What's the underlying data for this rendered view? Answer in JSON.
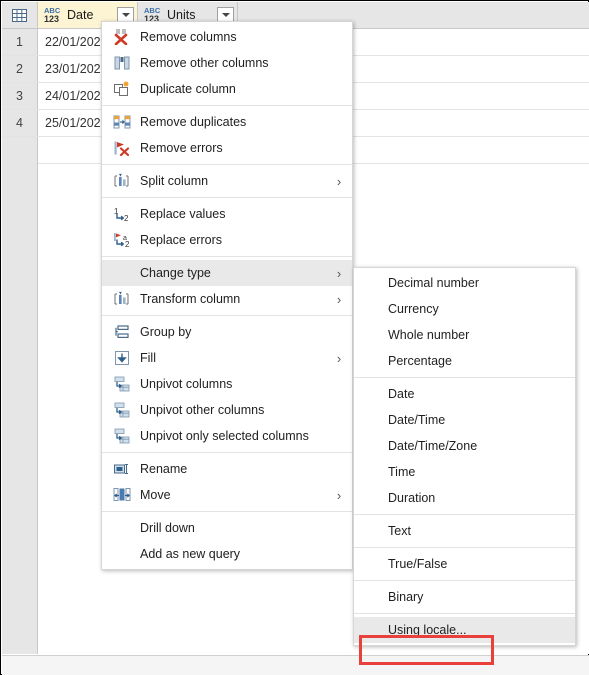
{
  "grid": {
    "corner_icon": "select-all-table-icon",
    "columns": [
      {
        "name": "Date",
        "type_icon": "abc123-any-type-icon",
        "selected": true,
        "width": 100,
        "filter_icon": "filter-dropdown-icon"
      },
      {
        "name": "Units",
        "type_icon": "abc123-any-type-icon",
        "selected": false,
        "width": 100,
        "filter_icon": "filter-dropdown-icon"
      }
    ],
    "rows": [
      {
        "num": "1",
        "cells": [
          "22/01/202",
          ""
        ]
      },
      {
        "num": "2",
        "cells": [
          "23/01/202",
          ""
        ]
      },
      {
        "num": "3",
        "cells": [
          "24/01/202",
          ""
        ]
      },
      {
        "num": "4",
        "cells": [
          "25/01/202",
          ""
        ]
      }
    ]
  },
  "context_menu": {
    "groups": [
      {
        "items": [
          {
            "label": "Remove columns",
            "icon": "remove-columns-icon",
            "submenu": false,
            "highlighted": false
          },
          {
            "label": "Remove other columns",
            "icon": "remove-other-columns-icon",
            "submenu": false,
            "highlighted": false
          },
          {
            "label": "Duplicate column",
            "icon": "duplicate-column-icon",
            "submenu": false,
            "highlighted": false
          }
        ]
      },
      {
        "items": [
          {
            "label": "Remove duplicates",
            "icon": "remove-duplicates-icon",
            "submenu": false,
            "highlighted": false
          },
          {
            "label": "Remove errors",
            "icon": "remove-errors-icon",
            "submenu": false,
            "highlighted": false
          }
        ]
      },
      {
        "items": [
          {
            "label": "Split column",
            "icon": "split-column-icon",
            "submenu": true,
            "highlighted": false
          }
        ]
      },
      {
        "items": [
          {
            "label": "Replace values",
            "icon": "replace-values-icon",
            "submenu": false,
            "highlighted": false
          },
          {
            "label": "Replace errors",
            "icon": "replace-errors-icon",
            "submenu": false,
            "highlighted": false
          }
        ]
      },
      {
        "items": [
          {
            "label": "Change type",
            "icon": "none",
            "submenu": true,
            "highlighted": true
          },
          {
            "label": "Transform column",
            "icon": "transform-column-icon",
            "submenu": true,
            "highlighted": false
          }
        ]
      },
      {
        "items": [
          {
            "label": "Group by",
            "icon": "group-by-icon",
            "submenu": false,
            "highlighted": false
          },
          {
            "label": "Fill",
            "icon": "fill-down-icon",
            "submenu": true,
            "highlighted": false
          },
          {
            "label": "Unpivot columns",
            "icon": "unpivot-icon",
            "submenu": false,
            "highlighted": false
          },
          {
            "label": "Unpivot other columns",
            "icon": "unpivot-icon",
            "submenu": false,
            "highlighted": false
          },
          {
            "label": "Unpivot only selected columns",
            "icon": "unpivot-icon",
            "submenu": false,
            "highlighted": false
          }
        ]
      },
      {
        "items": [
          {
            "label": "Rename",
            "icon": "rename-icon",
            "submenu": false,
            "highlighted": false
          },
          {
            "label": "Move",
            "icon": "move-icon",
            "submenu": true,
            "highlighted": false
          }
        ]
      },
      {
        "items": [
          {
            "label": "Drill down",
            "icon": "none",
            "submenu": false,
            "highlighted": false
          },
          {
            "label": "Add as new query",
            "icon": "none",
            "submenu": false,
            "highlighted": false
          }
        ]
      }
    ]
  },
  "submenu": {
    "title": "Change type",
    "groups": [
      {
        "items": [
          {
            "label": "Decimal number",
            "highlighted": false
          },
          {
            "label": "Currency",
            "highlighted": false
          },
          {
            "label": "Whole number",
            "highlighted": false
          },
          {
            "label": "Percentage",
            "highlighted": false
          }
        ]
      },
      {
        "items": [
          {
            "label": "Date",
            "highlighted": false
          },
          {
            "label": "Date/Time",
            "highlighted": false
          },
          {
            "label": "Date/Time/Zone",
            "highlighted": false
          },
          {
            "label": "Time",
            "highlighted": false
          },
          {
            "label": "Duration",
            "highlighted": false
          }
        ]
      },
      {
        "items": [
          {
            "label": "Text",
            "highlighted": false
          }
        ]
      },
      {
        "items": [
          {
            "label": "True/False",
            "highlighted": false
          }
        ]
      },
      {
        "items": [
          {
            "label": "Binary",
            "highlighted": false
          }
        ]
      },
      {
        "items": [
          {
            "label": "Using locale...",
            "highlighted": true
          }
        ]
      }
    ]
  },
  "annotation": {
    "target_label": "Using locale...",
    "color": "#e8413c"
  }
}
